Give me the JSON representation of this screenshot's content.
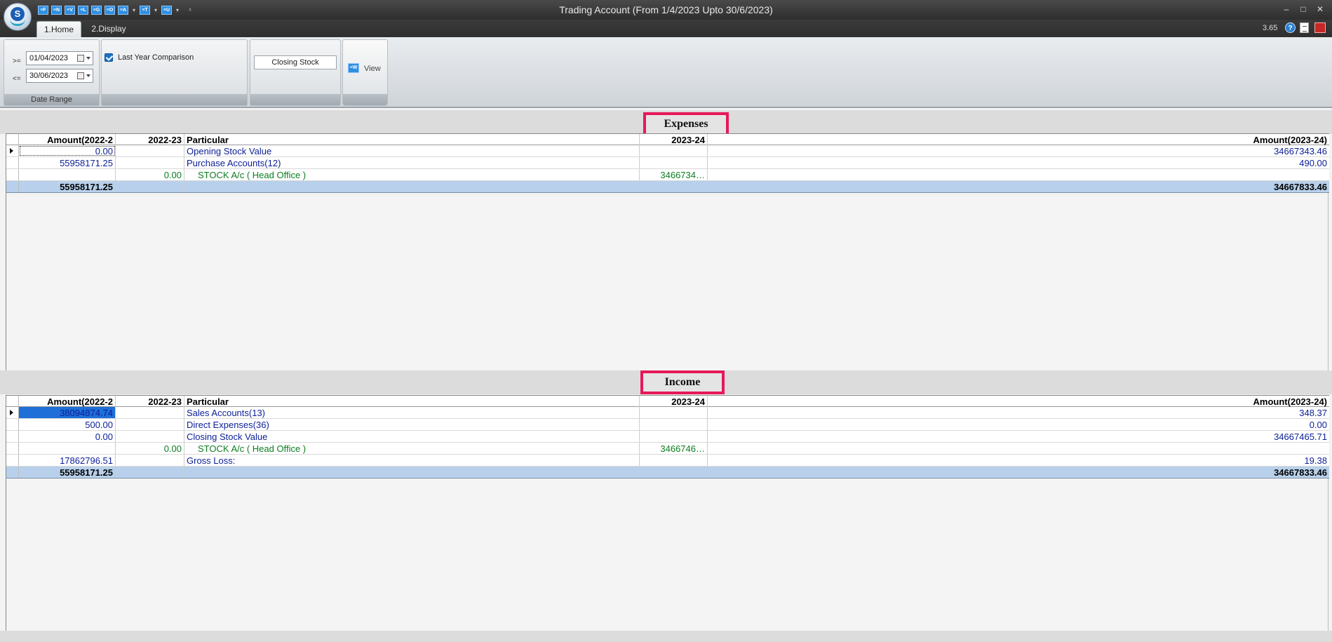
{
  "window": {
    "title": "Trading Account (From 1/4/2023 Upto 30/6/2023)",
    "minimize": "–",
    "maximize": "□",
    "close": "✕"
  },
  "quick_access": [
    "≡F",
    "≡N",
    "≡V",
    "≡L",
    "≡G",
    "≡O",
    "≡A",
    "≡T",
    "≡U"
  ],
  "tabs": [
    {
      "label": "1.Home",
      "active": true
    },
    {
      "label": "2.Display",
      "active": false
    }
  ],
  "version": "3.65",
  "ribbon": {
    "date_range": {
      "from_op": ">=",
      "from_value": "01/04/2023",
      "to_op": "<=",
      "to_value": "30/06/2023",
      "group_label": "Date Range"
    },
    "last_year_comparison": {
      "label": "Last Year Comparison",
      "checked": true
    },
    "closing_stock_label": "Closing Stock",
    "view_label": "View",
    "view_icon_text": "≡W"
  },
  "columns": [
    "Amount(2022-2",
    "2022-23",
    "Particular",
    "2023-24",
    "Amount(2023-24)"
  ],
  "expenses": {
    "title": "Expenses",
    "rows": [
      {
        "amt1": "0.00",
        "amt2": "",
        "particular": "Opening Stock Value",
        "y24": "",
        "amt24": "34667343.46",
        "color": "blue",
        "indent": false
      },
      {
        "amt1": "55958171.25",
        "amt2": "",
        "particular": "Purchase Accounts(12)",
        "y24": "",
        "amt24": "490.00",
        "color": "blue",
        "indent": false
      },
      {
        "amt1": "",
        "amt2": "0.00",
        "particular": "STOCK A/c ( Head Office )",
        "y24": "3466734…",
        "amt24": "",
        "color": "green",
        "indent": true
      }
    ],
    "total": {
      "amt1": "55958171.25",
      "amt24": "34667833.46"
    }
  },
  "income": {
    "title": "Income",
    "rows": [
      {
        "amt1": "38094874.74",
        "amt2": "",
        "particular": "Sales Accounts(13)",
        "y24": "",
        "amt24": "348.37",
        "color": "blue",
        "indent": false
      },
      {
        "amt1": "500.00",
        "amt2": "",
        "particular": "Direct Expenses(36)",
        "y24": "",
        "amt24": "0.00",
        "color": "blue",
        "indent": false
      },
      {
        "amt1": "0.00",
        "amt2": "",
        "particular": "Closing Stock Value",
        "y24": "",
        "amt24": "34667465.71",
        "color": "blue",
        "indent": false
      },
      {
        "amt1": "",
        "amt2": "0.00",
        "particular": "STOCK A/c ( Head Office )",
        "y24": "3466746…",
        "amt24": "",
        "color": "green",
        "indent": true
      },
      {
        "amt1": "17862796.51",
        "amt2": "",
        "particular": "Gross Loss:",
        "y24": "",
        "amt24": "19.38",
        "color": "blue",
        "indent": false
      }
    ],
    "total": {
      "amt1": "55958171.25",
      "amt24": "34667833.46"
    }
  }
}
